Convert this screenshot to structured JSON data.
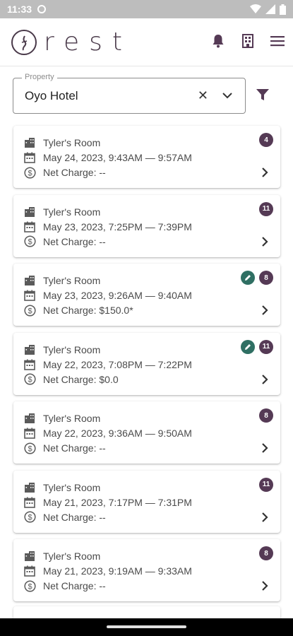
{
  "status_bar": {
    "time": "11:33"
  },
  "app": {
    "logo_text": "rest"
  },
  "filter": {
    "label": "Property",
    "value": "Oyo Hotel",
    "clear_glyph": "✕"
  },
  "icons": {
    "building": "building-icon",
    "calendar": "calendar-icon",
    "dollar": "dollar-circle-icon",
    "chevron": "chevron-right-icon",
    "edit": "pencil-icon",
    "bell": "bell-icon",
    "hotel": "hotel-building-icon",
    "menu": "hamburger-menu-icon",
    "filter": "filter-funnel-icon",
    "dropdown": "chevron-down-icon"
  },
  "colors": {
    "accent": "#553a55",
    "edit_badge": "#2f6f63"
  },
  "bookings": [
    {
      "room": "Tyler's Room",
      "date": "May 24, 2023,  9:43AM — 9:57AM",
      "charge": "Net Charge: --",
      "count": "4",
      "edited": false
    },
    {
      "room": "Tyler's Room",
      "date": "May 23, 2023,  7:25PM — 7:39PM",
      "charge": "Net Charge: --",
      "count": "11",
      "edited": false
    },
    {
      "room": "Tyler's Room",
      "date": "May 23, 2023,  9:26AM — 9:40AM",
      "charge": "Net Charge: $150.0*",
      "count": "8",
      "edited": true
    },
    {
      "room": "Tyler's Room",
      "date": "May 22, 2023,  7:08PM — 7:22PM",
      "charge": "Net Charge: $0.0",
      "count": "11",
      "edited": true
    },
    {
      "room": "Tyler's Room",
      "date": "May 22, 2023,  9:36AM — 9:50AM",
      "charge": "Net Charge: --",
      "count": "8",
      "edited": false
    },
    {
      "room": "Tyler's Room",
      "date": "May 21, 2023,  7:17PM — 7:31PM",
      "charge": "Net Charge: --",
      "count": "11",
      "edited": false
    },
    {
      "room": "Tyler's Room",
      "date": "May 21, 2023,  9:19AM — 9:33AM",
      "charge": "Net Charge: --",
      "count": "8",
      "edited": false
    }
  ]
}
